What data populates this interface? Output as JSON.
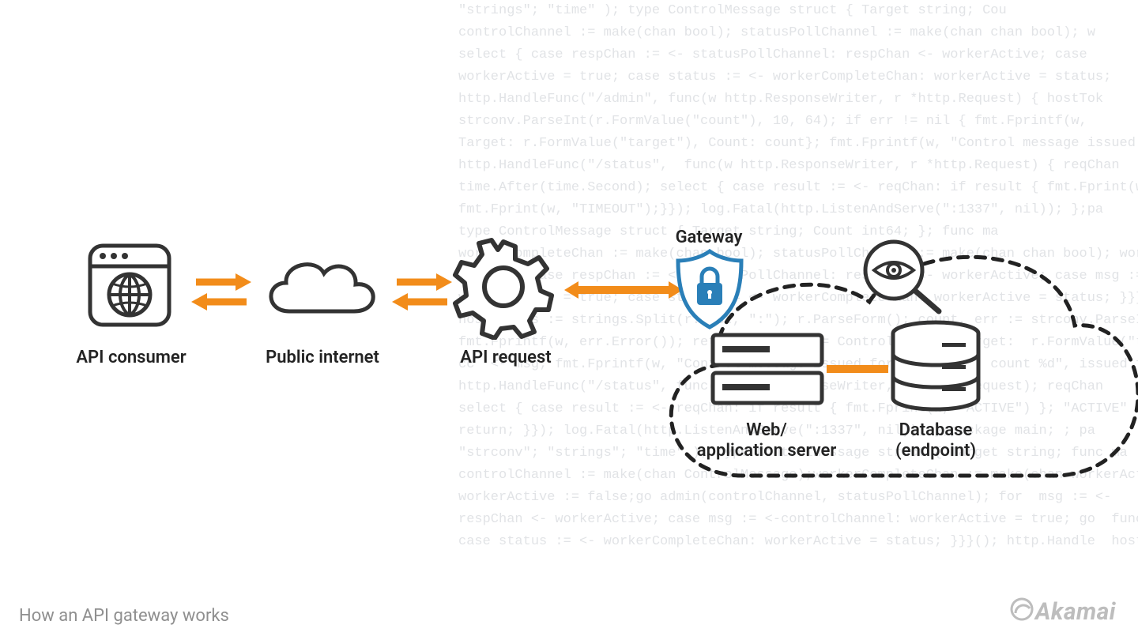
{
  "caption": "How an API gateway works",
  "brand": "Akamai",
  "labels": {
    "consumer": "API consumer",
    "internet": "Public internet",
    "request": "API request",
    "gateway": "Gateway",
    "webapp1": "Web/",
    "webapp2": "application server",
    "db1": "Database",
    "db2": "(endpoint)"
  },
  "code_bg": "\"strings\"; \"time\" ); type ControlMessage struct { Target string; Cou\ncontrolChannel := make(chan bool); statusPollChannel := make(chan chan bool); w\nselect { case respChan := <- statusPollChannel: respChan <- workerActive; case\nworkerActive = true; case status := <- workerCompleteChan: workerActive = status;\nhttp.HandleFunc(\"/admin\", func(w http.ResponseWriter, r *http.Request) { hostTok\nstrconv.ParseInt(r.FormValue(\"count\"), 10, 64); if err != nil { fmt.Fprintf(w,\nTarget: r.FormValue(\"target\"), Count: count}; fmt.Fprintf(w, \"Control message issued for Ta\nhttp.HandleFunc(\"/status\",  func(w http.ResponseWriter, r *http.Request) { reqChan\ntime.After(time.Second); select { case result := <- reqChan: if result { fmt.Fprint(w, \"ACTIVE\"\nfmt.Fprint(w, \"TIMEOUT\");}}); log.Fatal(http.ListenAndServe(\":1337\", nil)); };pa\ntype ControlMessage struct { Target string; Count int64; }; func ma\nworkerCompleteChan := make(chan bool); statusPollChannel := make(chan chan bool); workerAct\nselect { case respChan := <- statusPollChannel: respChan <- workerActive; case msg := <-\nworkerActive = true; case status := <- workerCompleteChan: workerActive = status; }}}(); func admin(c\nhostTokens := strings.Split(r.Host, \":\"); r.ParseForm(); count, err := strconv.ParseInt { hostTokens\nfmt.Fprintf(w, err.Error()); return; }; msg := ControlMessage{Target:  r.FormValue(\"ta fmt.Fprintf(w,\ncc  <- msg; fmt.Fprintf(w, \"Control message issued for Target %s, count %d\", issued for Ta\nhttp.HandleFunc(\"/status\", func(w http.ResponseWriter, r *http.Request); reqChan\nselect { case result := <- reqChan: if result { fmt.Fprint(w, \"ACTIVE\") }; \"ACTIVE\"\nreturn; }}); log.Fatal(http.ListenAndServe(\":1337\", nil)); };package main; ; pa\n\"strconv\"; \"strings\"; \"time\" ); type ControlMessage struct { Target string; func ma\ncontrolChannel := make(chan ControlMessage);workerCompleteChan := make(chan workerAct\nworkerActive := false;go admin(controlChannel, statusPollChannel); for  msg := <-\nrespChan <- workerActive; case msg := <-controlChannel: workerActive = true; go  func admin(c\ncase status := <- workerCompleteChan: workerActive = status; }}}(); http.Handle  hostTokens"
}
